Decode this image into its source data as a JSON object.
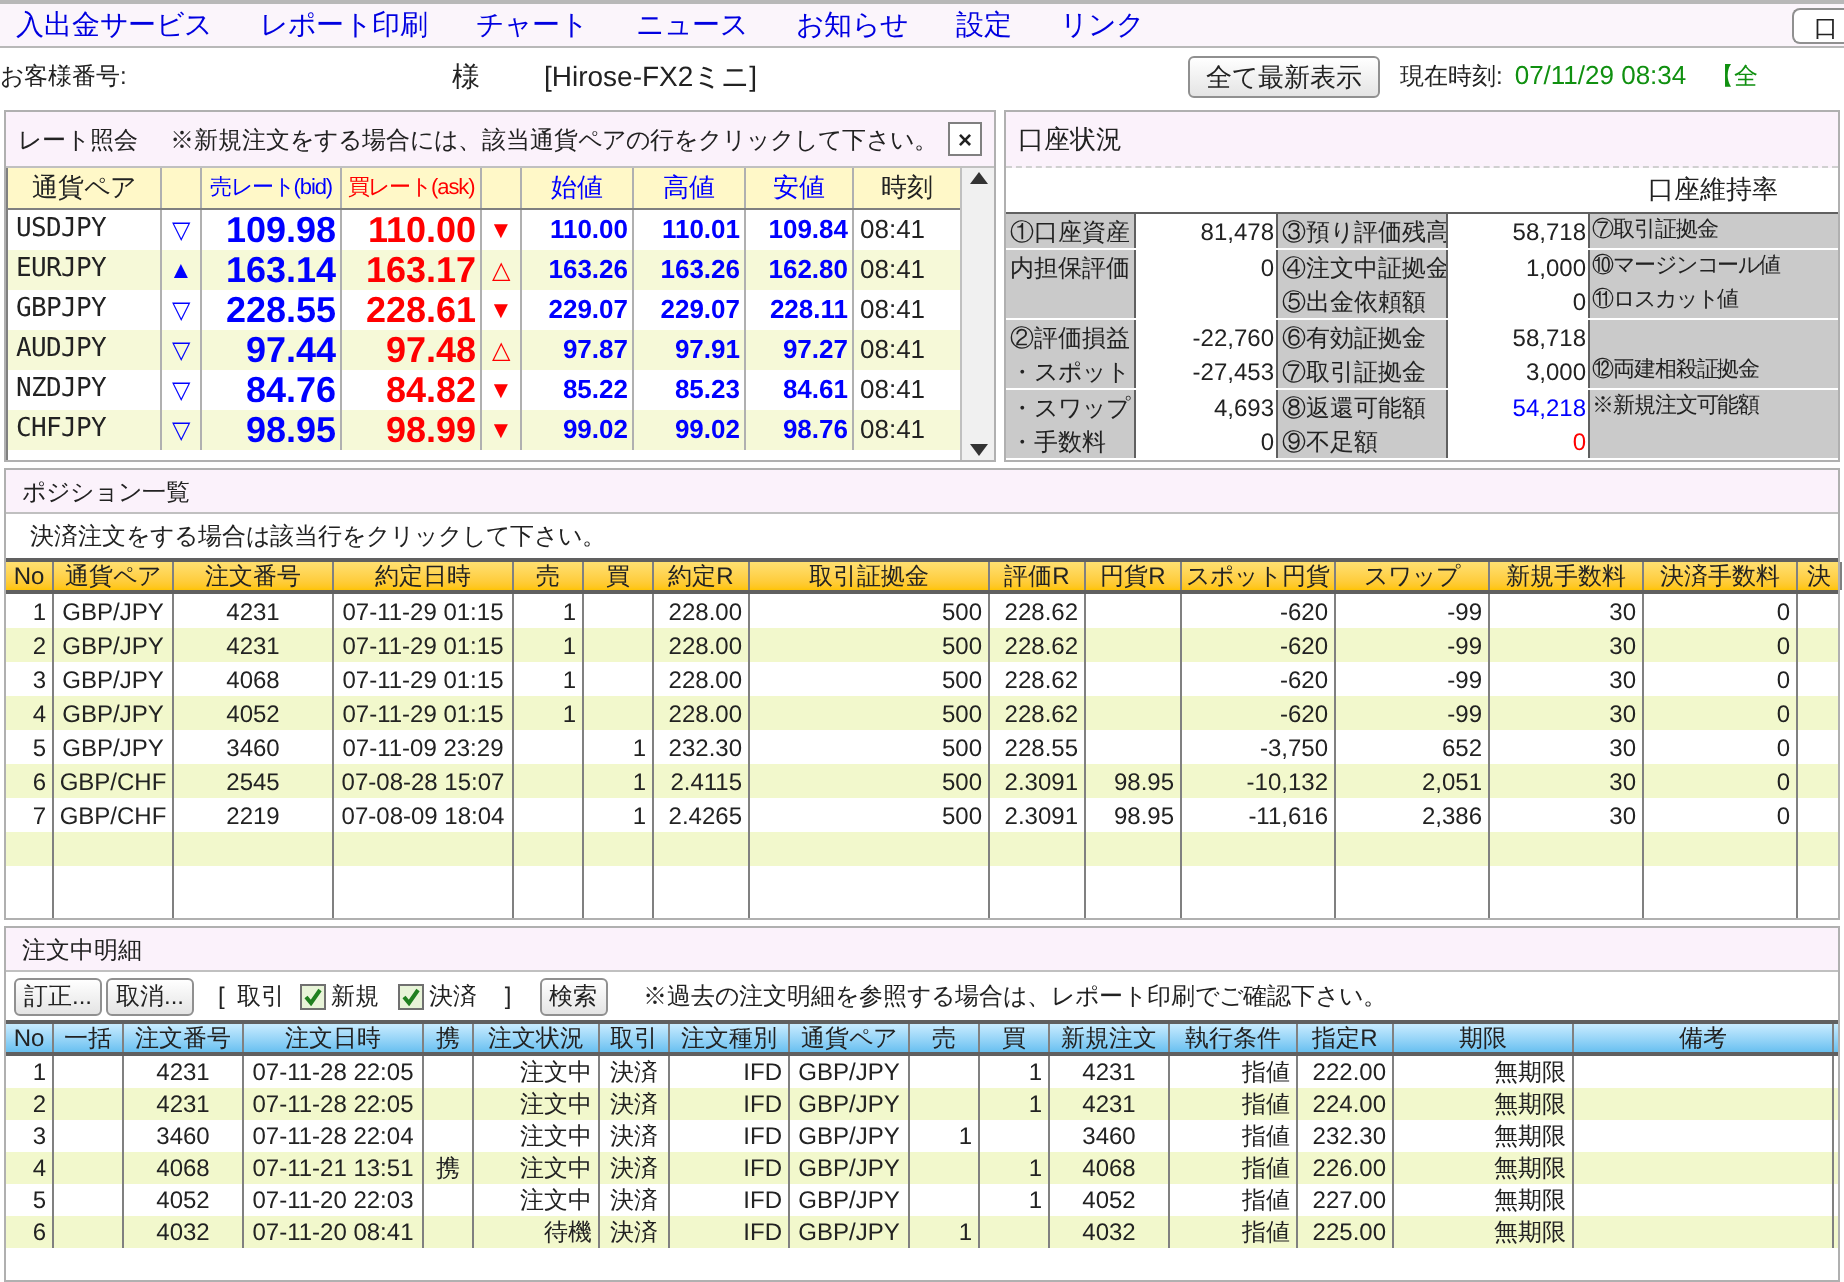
{
  "menu": [
    {
      "label": "入出金サービス"
    },
    {
      "label": "レポート印刷"
    },
    {
      "label": "チャート"
    },
    {
      "label": "ニュース"
    },
    {
      "label": "お知らせ"
    },
    {
      "label": "設定"
    },
    {
      "label": "リンク"
    }
  ],
  "corner_button": {
    "label": "口"
  },
  "customer": {
    "label": "お客様番号:",
    "honorific": "様",
    "product": "[Hirose-FX2ミニ]"
  },
  "refresh_button": {
    "label": "全て最新表示"
  },
  "clock": {
    "label": "現在時刻:",
    "value": "07/11/29 08:34",
    "extra": "【全"
  },
  "rates": {
    "title": "レート照会",
    "note": "※新規注文をする場合には、該当通貨ペアの行をクリックして下さい。",
    "close": "×",
    "columns": [
      "通貨ペア",
      "売レート(bid)",
      "買レート(ask)",
      "始値",
      "高値",
      "安値",
      "時刻"
    ],
    "rows": [
      {
        "pair": "USDJPY",
        "bid_mark": "▽",
        "bid": "109.98",
        "ask": "110.00",
        "ask_mark": "▼",
        "open": "110.00",
        "high": "110.01",
        "low": "109.84",
        "time": "08:41"
      },
      {
        "pair": "EURJPY",
        "bid_mark": "▲",
        "bid": "163.14",
        "ask": "163.17",
        "ask_mark": "△",
        "open": "163.26",
        "high": "163.26",
        "low": "162.80",
        "time": "08:41"
      },
      {
        "pair": "GBPJPY",
        "bid_mark": "▽",
        "bid": "228.55",
        "ask": "228.61",
        "ask_mark": "▼",
        "open": "229.07",
        "high": "229.07",
        "low": "228.11",
        "time": "08:41"
      },
      {
        "pair": "AUDJPY",
        "bid_mark": "▽",
        "bid": "97.44",
        "ask": "97.48",
        "ask_mark": "△",
        "open": "97.87",
        "high": "97.91",
        "low": "97.27",
        "time": "08:41"
      },
      {
        "pair": "NZDJPY",
        "bid_mark": "▽",
        "bid": "84.76",
        "ask": "84.82",
        "ask_mark": "▼",
        "open": "85.22",
        "high": "85.23",
        "low": "84.61",
        "time": "08:41"
      },
      {
        "pair": "CHFJPY",
        "bid_mark": "▽",
        "bid": "98.95",
        "ask": "98.99",
        "ask_mark": "▼",
        "open": "99.02",
        "high": "99.02",
        "low": "98.76",
        "time": "08:41"
      }
    ]
  },
  "account": {
    "title": "口座状況",
    "ratio_label": "口座維持率",
    "rows": [
      {
        "label_1": "①口座資産",
        "value_1": "81,478",
        "label_2": "③預り評価残高",
        "value_2": "58,718",
        "label_3": "⑦取引証拠金"
      },
      {
        "label_1": "内担保評価",
        "value_1": "0",
        "label_2": "④注文中証拠金",
        "value_2": "1,000",
        "label_3": "⑩マージンコール値"
      },
      {
        "label_2": "⑤出金依頼額",
        "value_2": "0",
        "label_3": "⑪ロスカット値"
      },
      {
        "label_1": "②評価損益",
        "value_1": "-22,760",
        "label_2": "⑥有効証拠金",
        "value_2": "58,718"
      },
      {
        "label_1": "・スポット",
        "value_1": "-27,453",
        "label_2": "⑦取引証拠金",
        "value_2": "3,000",
        "label_3": "⑫両建相殺証拠金"
      },
      {
        "label_1": "・スワップ",
        "value_1": "4,693",
        "label_2": "⑧返還可能額",
        "value_2": "54,218",
        "color": "#0000ff",
        "label_3": "※新規注文可能額"
      },
      {
        "label_1": "・手数料",
        "value_1": "0",
        "label_2": "⑨不足額",
        "value_2": "0",
        "color": "#ff0000"
      }
    ]
  },
  "positions": {
    "title": "ポジション一覧",
    "note": "決済注文をする場合は該当行をクリックして下さい。",
    "columns": [
      "No",
      "通貨ペア",
      "注文番号",
      "約定日時",
      "売",
      "買",
      "約定R",
      "取引証拠金",
      "評価R",
      "円貨R",
      "スポット円貨",
      "スワップ",
      "新規手数料",
      "決済手数料",
      "決"
    ],
    "rows": [
      [
        "1",
        "GBP/JPY",
        "4231",
        "07-11-29 01:15",
        "1",
        null,
        "228.00",
        "500",
        "228.62",
        null,
        "-620",
        "-99",
        "30",
        "0"
      ],
      [
        "2",
        "GBP/JPY",
        "4231",
        "07-11-29 01:15",
        "1",
        null,
        "228.00",
        "500",
        "228.62",
        null,
        "-620",
        "-99",
        "30",
        "0"
      ],
      [
        "3",
        "GBP/JPY",
        "4068",
        "07-11-29 01:15",
        "1",
        null,
        "228.00",
        "500",
        "228.62",
        null,
        "-620",
        "-99",
        "30",
        "0"
      ],
      [
        "4",
        "GBP/JPY",
        "4052",
        "07-11-29 01:15",
        "1",
        null,
        "228.00",
        "500",
        "228.62",
        null,
        "-620",
        "-99",
        "30",
        "0"
      ],
      [
        "5",
        "GBP/JPY",
        "3460",
        "07-11-09 23:29",
        null,
        "1",
        "232.30",
        "500",
        "228.55",
        null,
        "-3,750",
        "652",
        "30",
        "0"
      ],
      [
        "6",
        "GBP/CHF",
        "2545",
        "07-08-28 15:07",
        null,
        "1",
        "2.4115",
        "500",
        "2.3091",
        "98.95",
        "-10,132",
        "2,051",
        "30",
        "0"
      ],
      [
        "7",
        "GBP/CHF",
        "2219",
        "07-08-09 18:04",
        null,
        "1",
        "2.4265",
        "500",
        "2.3091",
        "98.95",
        "-11,616",
        "2,386",
        "30",
        "0"
      ]
    ]
  },
  "orders": {
    "title": "注文中明細",
    "buttons": [
      "訂正...",
      "取消..."
    ],
    "bracket_open": "[",
    "filter_label": "取引",
    "filters": [
      {
        "label": "新規",
        "checked": true
      },
      {
        "label": "決済",
        "checked": true
      }
    ],
    "bracket_close": "]",
    "search_button": "検索",
    "note": "※過去の注文明細を参照する場合は、レポート印刷でご確認下さい。",
    "columns": [
      "No",
      "一括",
      "注文番号",
      "注文日時",
      "携",
      "注文状況",
      "取引",
      "注文種別",
      "通貨ペア",
      "売",
      "買",
      "新規注文",
      "執行条件",
      "指定R",
      "期限",
      "備考"
    ],
    "rows": [
      [
        "1",
        null,
        "4231",
        "07-11-28 22:05",
        null,
        "注文中",
        "決済",
        "IFD",
        "GBP/JPY",
        null,
        "1",
        "4231",
        "指値",
        "222.00",
        "無期限",
        null
      ],
      [
        "2",
        null,
        "4231",
        "07-11-28 22:05",
        null,
        "注文中",
        "決済",
        "IFD",
        "GBP/JPY",
        null,
        "1",
        "4231",
        "指値",
        "224.00",
        "無期限",
        null
      ],
      [
        "3",
        null,
        "3460",
        "07-11-28 22:04",
        null,
        "注文中",
        "決済",
        "IFD",
        "GBP/JPY",
        "1",
        null,
        "3460",
        "指値",
        "232.30",
        "無期限",
        null
      ],
      [
        "4",
        null,
        "4068",
        "07-11-21 13:51",
        "携",
        "注文中",
        "決済",
        "IFD",
        "GBP/JPY",
        null,
        "1",
        "4068",
        "指値",
        "226.00",
        "無期限",
        null
      ],
      [
        "5",
        null,
        "4052",
        "07-11-20 22:03",
        null,
        "注文中",
        "決済",
        "IFD",
        "GBP/JPY",
        null,
        "1",
        "4052",
        "指値",
        "227.00",
        "無期限",
        null
      ],
      [
        "6",
        null,
        "4032",
        "07-11-20 08:41",
        null,
        "待機",
        "決済",
        "IFD",
        "GBP/JPY",
        "1",
        null,
        "4032",
        "指値",
        "225.00",
        "無期限",
        null
      ]
    ]
  }
}
